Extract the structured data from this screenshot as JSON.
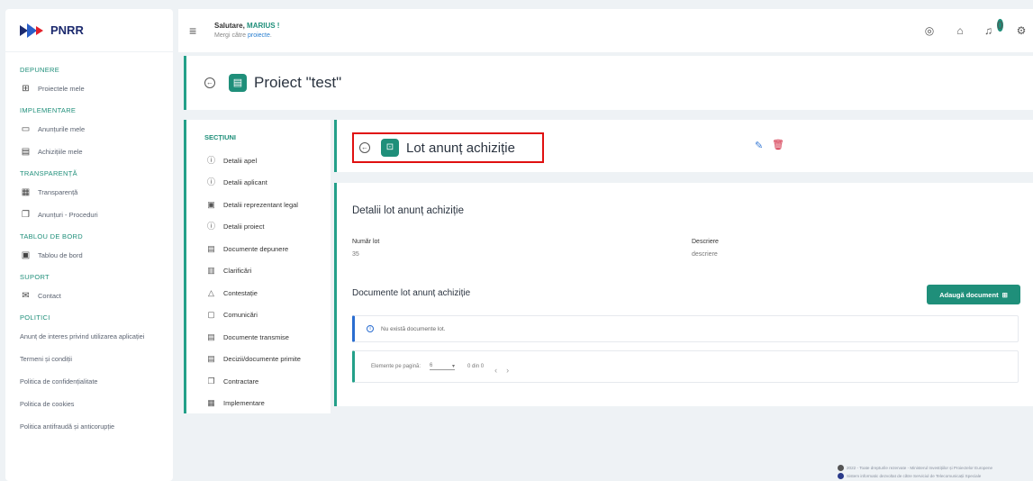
{
  "brand": {
    "name": "PNRR"
  },
  "sidebar": {
    "sections": [
      {
        "title": "DEPUNERE",
        "items": [
          {
            "label": "Proiectele mele",
            "icon": "add-document-icon"
          }
        ]
      },
      {
        "title": "IMPLEMENTARE",
        "items": [
          {
            "label": "Anunțurile mele",
            "icon": "folder-icon"
          },
          {
            "label": "Achizițiile mele",
            "icon": "document-icon"
          }
        ]
      },
      {
        "title": "TRANSPARENȚĂ",
        "items": [
          {
            "label": "Transparență",
            "icon": "table-icon"
          },
          {
            "label": "Anunțuri - Proceduri",
            "icon": "copy-icon"
          }
        ]
      },
      {
        "title": "TABLOU DE BORD",
        "items": [
          {
            "label": "Tablou de bord",
            "icon": "monitor-icon"
          }
        ]
      },
      {
        "title": "SUPORT",
        "items": [
          {
            "label": "Contact",
            "icon": "mail-icon"
          }
        ]
      }
    ],
    "policies_title": "POLITICI",
    "policies": [
      "Anunț de interes privind utilizarea aplicației",
      "Termeni și condiții",
      "Politica de confidențialitate",
      "Politica de cookies",
      "Politica antifraudă și anticorupție"
    ]
  },
  "topbar": {
    "greeting": "Salutare,",
    "user_name": "MARIUS !",
    "subtext": "Mergi către",
    "subtext_link": "proiecte",
    "subtext_end": ".",
    "notification_count": "0"
  },
  "project": {
    "title": "Proiect \"test\""
  },
  "sections_panel": {
    "title": "SECȚIUNI",
    "items": [
      {
        "label": "Detalii apel",
        "icon": "info-icon"
      },
      {
        "label": "Detalii aplicant",
        "icon": "info-icon"
      },
      {
        "label": "Detalii reprezentant legal",
        "icon": "id-card-icon"
      },
      {
        "label": "Detalii proiect",
        "icon": "info-icon"
      },
      {
        "label": "Documente depunere",
        "icon": "document-icon"
      },
      {
        "label": "Clarificări",
        "icon": "clipboard-icon"
      },
      {
        "label": "Contestație",
        "icon": "warning-icon"
      },
      {
        "label": "Comunicări",
        "icon": "chat-icon"
      },
      {
        "label": "Documente transmise",
        "icon": "document-icon"
      },
      {
        "label": "Decizii/documente primite",
        "icon": "document-icon"
      },
      {
        "label": "Contractare",
        "icon": "copy-icon"
      },
      {
        "label": "Implementare",
        "icon": "calendar-icon"
      }
    ]
  },
  "lot": {
    "title": "Lot anunț achiziție",
    "details_title": "Detalii lot anunț achiziție",
    "fields": [
      {
        "label": "Număr lot",
        "value": "35"
      },
      {
        "label": "Descriere",
        "value": "descriere"
      }
    ],
    "documents_title": "Documente lot anunț achiziție",
    "add_document": "Adaugă document",
    "empty_message": "Nu există documente lot.",
    "pager": {
      "label": "Elemente pe pagină:",
      "page_size": "6",
      "range": "0 din 0"
    }
  },
  "footer": {
    "line1": "2022 - Toate drepturile rezervate - Ministerul Investițiilor și Proiectelor Europene",
    "line2": "Sistem informatic dezvoltat de către Serviciul de Telecomunicații Speciale"
  },
  "colors": {
    "accent": "#1f8f7a",
    "highlight": "#e01010",
    "danger": "#d0213a",
    "info": "#2a6dd0"
  }
}
